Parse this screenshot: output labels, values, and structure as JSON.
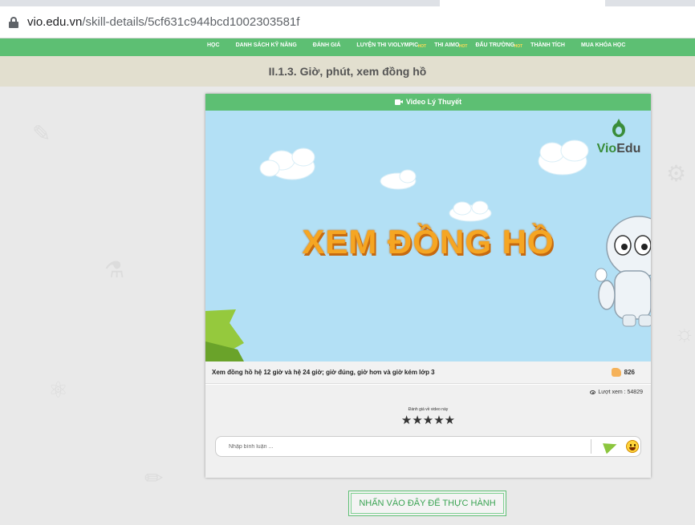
{
  "browser": {
    "url_host": "vio.edu.vn",
    "url_path": "/skill-details/5cf631c944bcd1002303581f"
  },
  "nav": {
    "items": [
      {
        "label": "Học",
        "badge": ""
      },
      {
        "label": "Danh sách kỹ năng",
        "badge": ""
      },
      {
        "label": "Đánh giá",
        "badge": ""
      },
      {
        "label": "Luyện thi Violympic",
        "badge": "HOT"
      },
      {
        "label": "Thi AIMO",
        "badge": "HOT"
      },
      {
        "label": "Đấu trường",
        "badge": "HOT"
      },
      {
        "label": "Thành tích",
        "badge": ""
      },
      {
        "label": "Mua khóa học",
        "badge": ""
      }
    ]
  },
  "page": {
    "title": "II.1.3. Giờ, phút, xem đồng hồ"
  },
  "card": {
    "header_label": "Video Lý Thuyết",
    "video_title": "XEM ĐỒNG HỒ",
    "logo_text_vio": "Vio",
    "logo_text_edu": "Edu",
    "caption": "Xem đồng hồ hệ 12 giờ và hệ 24 giờ; giờ đúng, giờ hơn và giờ kém lớp 3",
    "likes": "826",
    "views": "Lượt xem : 54829",
    "rate_label": "Đánh giá về video này",
    "stars": "★★★★★",
    "rating_max": 5,
    "comment_placeholder": "Nhập bình luận ..."
  },
  "practice_button": "NHẤN VÀO ĐÂY ĐỂ THỰC HÀNH",
  "colors": {
    "green": "#5dbf73",
    "video_bg": "#b3e0f5",
    "title_orange": "#f5a623"
  }
}
